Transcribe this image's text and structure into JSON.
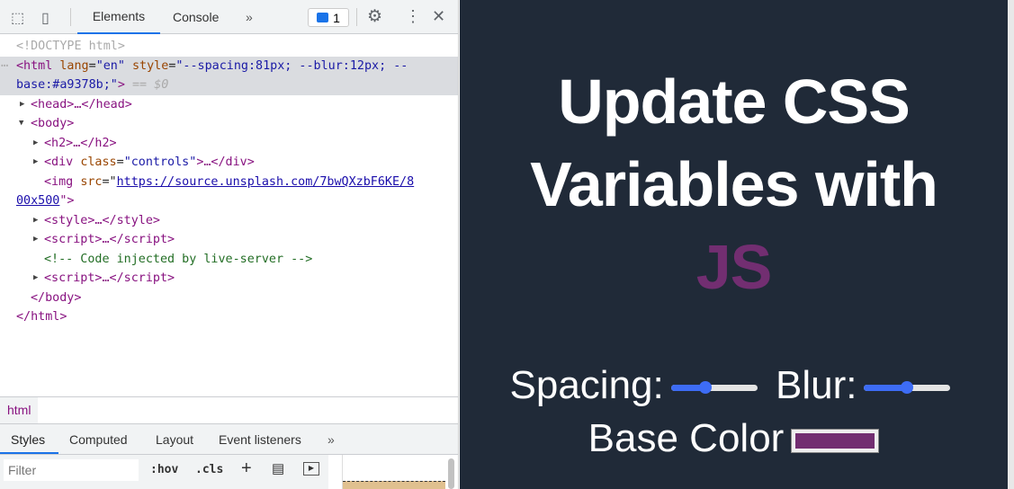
{
  "devtools": {
    "tabs": [
      "Elements",
      "Console"
    ],
    "more": "»",
    "issues_count": "1",
    "dom": {
      "doctype": "<!DOCTYPE html>",
      "html_open": "<html",
      "lang_attr": "lang",
      "lang_val": "\"en\"",
      "style_attr": "style",
      "style_val_1": "\"--spacing:81px; --blur:12px; --",
      "style_val_2": "base:#a9378b;\"",
      "close_bracket": ">",
      "eq": " == ",
      "dollar": "$0",
      "head": "<head>…</head>",
      "body_open": "<body>",
      "h2": "<h2>…</h2>",
      "div_open": "<div ",
      "div_class_attr": "class",
      "div_class_val": "\"controls\"",
      "div_close": ">…</div>",
      "img_open": "<img ",
      "img_src_attr": "src",
      "img_src_1": "https://source.unsplash.com/7bwQXzbF6KE/8",
      "img_src_2": "00x500",
      "img_end": "\">",
      "style": "<style>…</style>",
      "script1": "<script>…</script>",
      "comment": "<!-- Code injected by live-server -->",
      "script2": "<script>…</script>",
      "body_close": "</body>",
      "html_close": "</html>"
    },
    "breadcrumb": "html",
    "styles_tabs": [
      "Styles",
      "Computed",
      "Layout",
      "Event listeners"
    ],
    "filter_placeholder": "Filter",
    "hov": ":hov",
    "cls": ".cls"
  },
  "page": {
    "title_line1": "Update CSS",
    "title_line2": "Variables with",
    "title_js": "JS",
    "spacing_label": "Spacing:",
    "blur_label": "Blur:",
    "base_label": "Base Color",
    "spacing_pct": 40,
    "blur_pct": 50,
    "base_color": "#722e71"
  }
}
